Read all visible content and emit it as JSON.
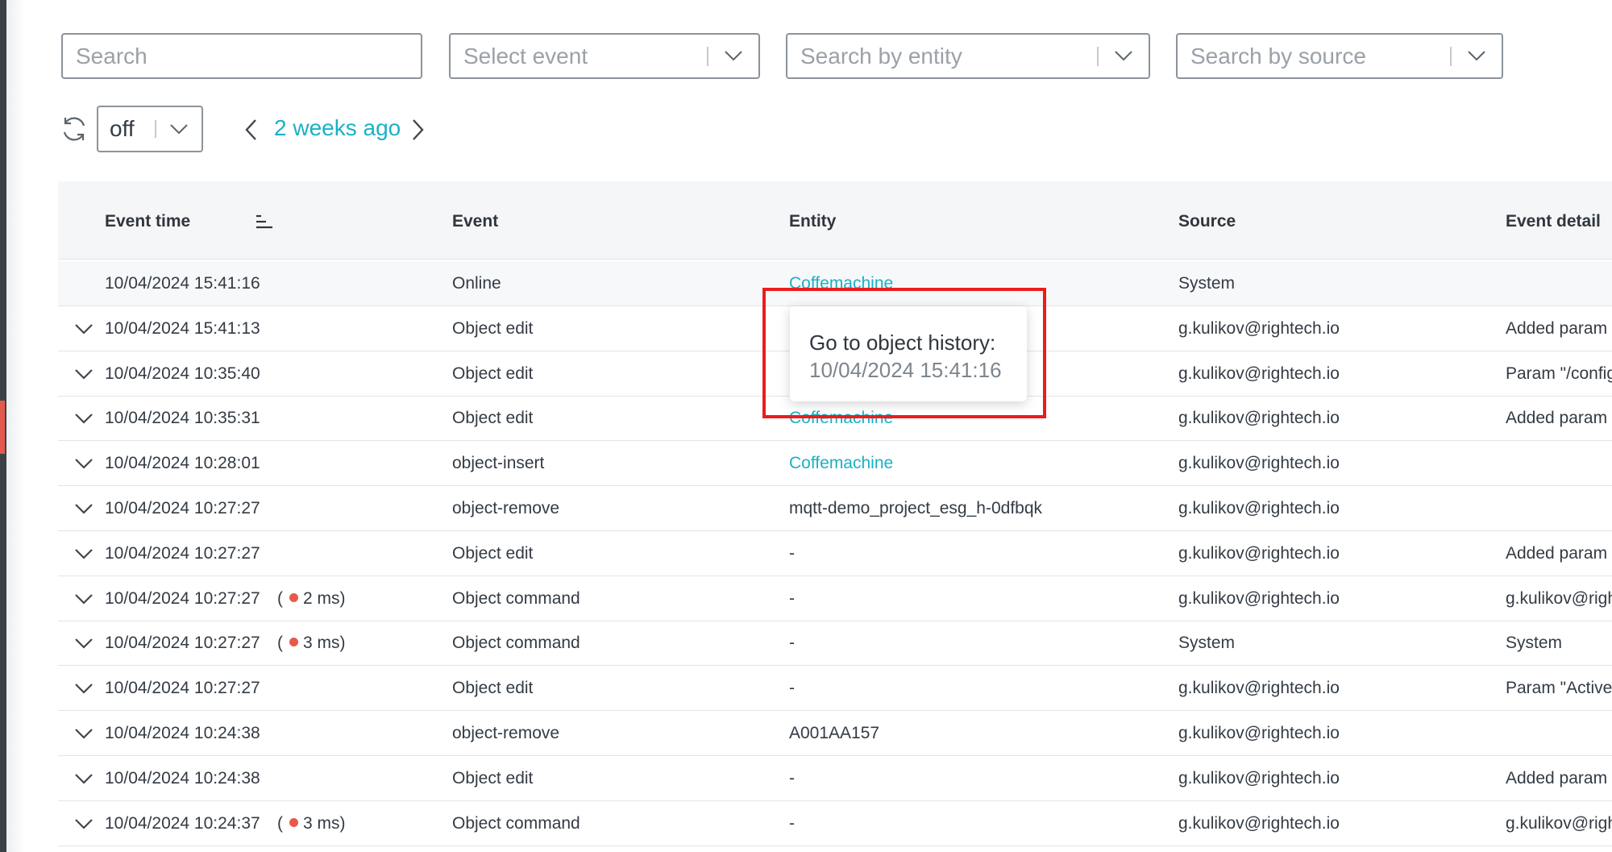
{
  "filters": {
    "search_placeholder": "Search",
    "event_placeholder": "Select event",
    "entity_placeholder": "Search by entity",
    "source_placeholder": "Search by source"
  },
  "refresh": {
    "interval_value": "off"
  },
  "period": {
    "label": "2 weeks ago"
  },
  "table": {
    "columns": {
      "event_time": "Event time",
      "event": "Event",
      "entity": "Entity",
      "source": "Source",
      "event_detail": "Event detail"
    },
    "rows": [
      {
        "time": "10/04/2024 15:41:16",
        "duration": "",
        "event": "Online",
        "entity": "Coffemachine",
        "source": "System",
        "detail": ""
      },
      {
        "time": "10/04/2024 15:41:13",
        "duration": "",
        "event": "Object edit",
        "entity": "",
        "source": "g.kulikov@rightech.io",
        "detail": "Added param"
      },
      {
        "time": "10/04/2024 10:35:40",
        "duration": "",
        "event": "Object edit",
        "entity": "",
        "source": "g.kulikov@rightech.io",
        "detail": "Param \"/config"
      },
      {
        "time": "10/04/2024 10:35:31",
        "duration": "",
        "event": "Object edit",
        "entity": "Coffemachine",
        "source": "g.kulikov@rightech.io",
        "detail": "Added param"
      },
      {
        "time": "10/04/2024 10:28:01",
        "duration": "",
        "event": "object-insert",
        "entity": "Coffemachine",
        "source": "g.kulikov@rightech.io",
        "detail": ""
      },
      {
        "time": "10/04/2024 10:27:27",
        "duration": "",
        "event": "object-remove",
        "entity": "mqtt-demo_project_esg_h-0dfbqk",
        "source": "g.kulikov@rightech.io",
        "detail": ""
      },
      {
        "time": "10/04/2024 10:27:27",
        "duration": "",
        "event": "Object edit",
        "entity": "-",
        "source": "g.kulikov@rightech.io",
        "detail": "Added param"
      },
      {
        "time": "10/04/2024 10:27:27",
        "duration": "2 ms",
        "event": "Object command",
        "entity": "-",
        "source": "g.kulikov@rightech.io",
        "detail": "g.kulikov@righ"
      },
      {
        "time": "10/04/2024 10:27:27",
        "duration": "3 ms",
        "event": "Object command",
        "entity": "-",
        "source": "System",
        "detail": "System"
      },
      {
        "time": "10/04/2024 10:27:27",
        "duration": "",
        "event": "Object edit",
        "entity": "-",
        "source": "g.kulikov@rightech.io",
        "detail": "Param \"Active\""
      },
      {
        "time": "10/04/2024 10:24:38",
        "duration": "",
        "event": "object-remove",
        "entity": "A001AA157",
        "source": "g.kulikov@rightech.io",
        "detail": ""
      },
      {
        "time": "10/04/2024 10:24:38",
        "duration": "",
        "event": "Object edit",
        "entity": "-",
        "source": "g.kulikov@rightech.io",
        "detail": "Added param"
      },
      {
        "time": "10/04/2024 10:24:37",
        "duration": "3 ms",
        "event": "Object command",
        "entity": "-",
        "source": "g.kulikov@rightech.io",
        "detail": "g.kulikov@righ"
      }
    ]
  },
  "tooltip": {
    "title": "Go to object history:",
    "time": "10/04/2024 15:41:16"
  },
  "colors": {
    "accent": "#1ab1c5",
    "highlight": "#ec1c1c",
    "duration_dot": "#e9584b"
  }
}
